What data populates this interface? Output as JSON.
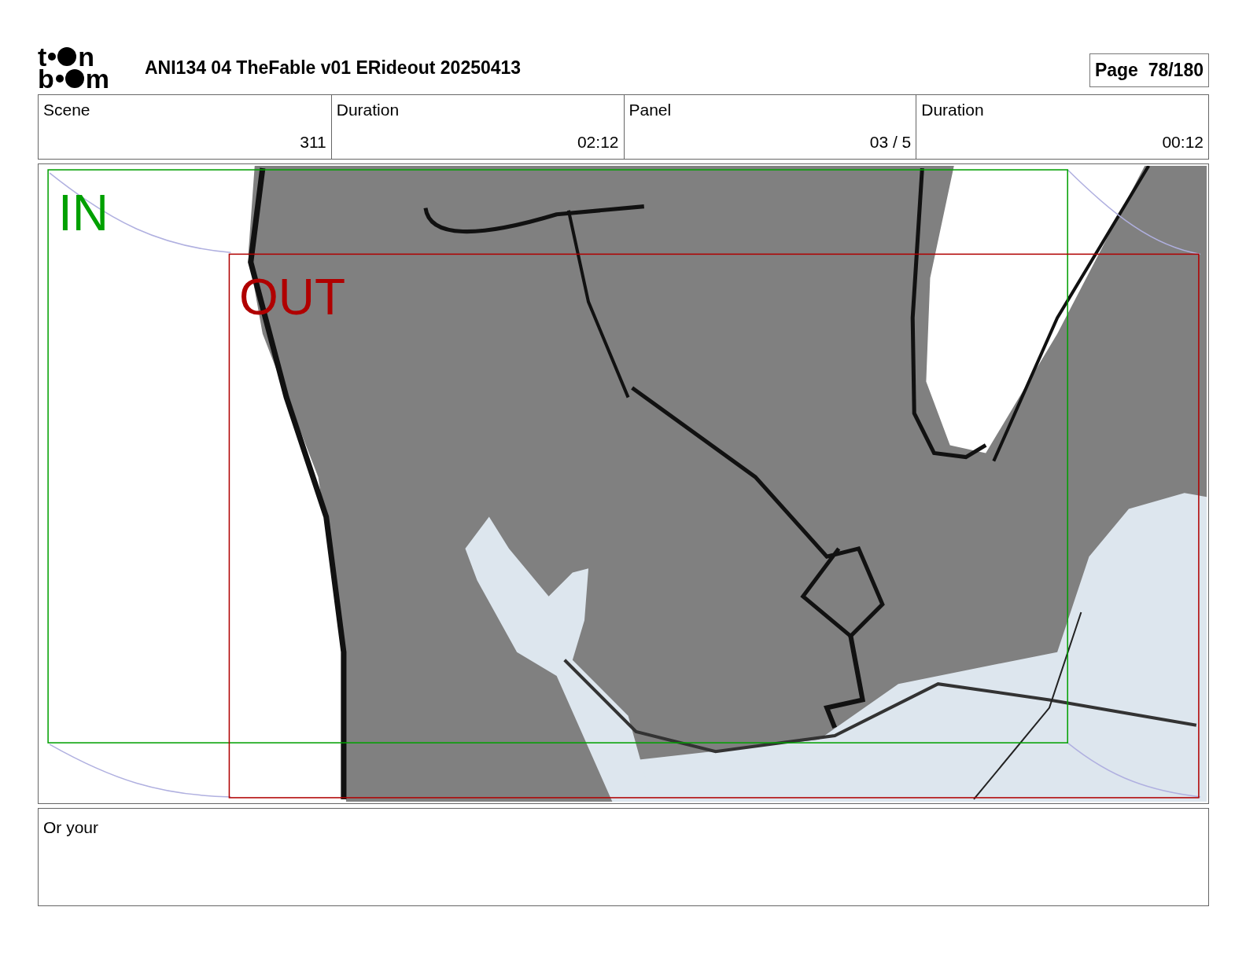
{
  "logo": {
    "top": [
      "t",
      "n"
    ],
    "bottom": [
      "b",
      "m"
    ]
  },
  "title": "ANI134 04 TheFable v01 ERideout 20250413",
  "page": {
    "label": "Page",
    "number": "78/180"
  },
  "info_table": {
    "columns": [
      "Scene",
      "Duration",
      "Panel",
      "Duration"
    ],
    "values": [
      "311",
      "02:12",
      "03 / 5",
      "00:12"
    ]
  },
  "frames": [
    {
      "label": "IN",
      "color": "#00a000"
    },
    {
      "label": "OUT",
      "color": "#b00000"
    }
  ],
  "notes": "Or your"
}
